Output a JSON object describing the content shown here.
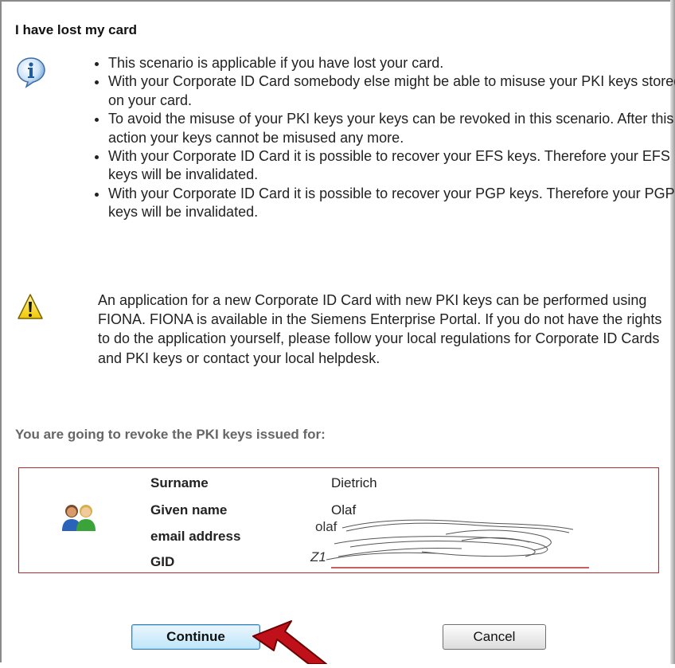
{
  "dialog": {
    "title": "I have lost my card"
  },
  "info": {
    "icon": "info-icon",
    "bullets": [
      "This scenario is applicable if you have lost your card.",
      "With your Corporate ID Card somebody else might be able to misuse your PKI keys stored on your card.",
      "To avoid the misuse of your PKI keys your keys can be revoked in this scenario. After this action your keys cannot be misused any more.",
      "With your Corporate ID Card it is possible to recover your EFS keys. Therefore your EFS keys will be invalidated.",
      "With your Corporate ID Card it is possible to recover your PGP keys. Therefore your PGP keys will be invalidated."
    ]
  },
  "warning": {
    "icon": "warning-icon",
    "text": "An application for a new Corporate ID Card with new PKI keys can be performed using FIONA. FIONA is available in the Siemens Enterprise Portal. If you do not have the rights to do the application yourself, please follow your local regulations for Corporate ID Cards and PKI keys or contact your local helpdesk."
  },
  "revoke_heading": "You are going to revoke the PKI keys issued for:",
  "user": {
    "icon": "users-icon",
    "surname_label": "Surname",
    "surname_value": "Dietrich",
    "given_name_label": "Given name",
    "given_name_value": "Olaf",
    "email_label": "email address",
    "email_value_visible": "olaf",
    "gid_label": "GID",
    "gid_value_visible": "Z1"
  },
  "buttons": {
    "continue_label": "Continue",
    "cancel_label": "Cancel"
  },
  "colors": {
    "box_border": "#b52a2a",
    "arrow": "#c0101a",
    "heading_gray": "#666666",
    "continue_bg": "#bfe6f9"
  }
}
